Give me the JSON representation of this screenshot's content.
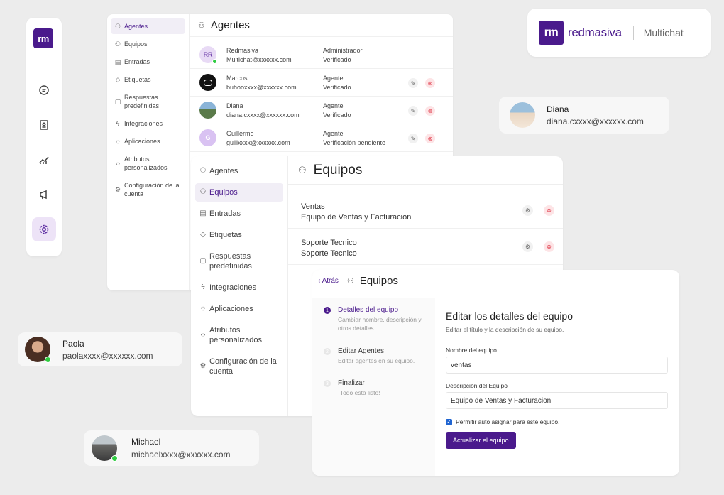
{
  "brand": {
    "mark": "rm",
    "name": "redmasiva",
    "product": "Multichat"
  },
  "rail": {
    "logo": "rm",
    "icons": [
      "chat-icon",
      "contacts-icon",
      "reports-icon",
      "campaigns-icon",
      "settings-icon"
    ]
  },
  "agentes_panel": {
    "title": "Agentes",
    "sidebar": [
      {
        "label": "Agentes",
        "icon": "agents-icon"
      },
      {
        "label": "Equipos",
        "icon": "teams-icon"
      },
      {
        "label": "Entradas",
        "icon": "inbox-icon"
      },
      {
        "label": "Etiquetas",
        "icon": "tag-icon"
      },
      {
        "label": "Respuestas predefinidas",
        "icon": "message-icon"
      },
      {
        "label": "Integraciones",
        "icon": "plug-icon"
      },
      {
        "label": "Aplicaciones",
        "icon": "apps-icon"
      },
      {
        "label": "Atributos personalizados",
        "icon": "code-icon"
      },
      {
        "label": "Configuración de la cuenta",
        "icon": "settings-icon"
      }
    ],
    "agents": [
      {
        "initials": "RR",
        "name": "Redmasiva",
        "email": "Multichat@xxxxxx.com",
        "role": "Administrador",
        "status": "Verificado"
      },
      {
        "initials": "",
        "name": "Marcos",
        "email": "buhooxxxx@xxxxxx.com",
        "role": "Agente",
        "status": "Verificado"
      },
      {
        "initials": "",
        "name": "Diana",
        "email": "diana.cxxxx@xxxxxx.com",
        "role": "Agente",
        "status": "Verificado"
      },
      {
        "initials": "G",
        "name": "Guillermo",
        "email": "gullixxxx@xxxxxx.com",
        "role": "Agente",
        "status": "Verificación pendiente"
      }
    ]
  },
  "equipos_panel": {
    "title": "Equipos",
    "sidebar": [
      {
        "label": "Agentes",
        "icon": "agents-icon"
      },
      {
        "label": "Equipos",
        "icon": "teams-icon"
      },
      {
        "label": "Entradas",
        "icon": "inbox-icon"
      },
      {
        "label": "Etiquetas",
        "icon": "tag-icon"
      },
      {
        "label": "Respuestas predefinidas",
        "icon": "message-icon"
      },
      {
        "label": "Integraciones",
        "icon": "plug-icon"
      },
      {
        "label": "Aplicaciones",
        "icon": "apps-icon"
      },
      {
        "label": "Atributos personalizados",
        "icon": "code-icon"
      },
      {
        "label": "Configuración de la cuenta",
        "icon": "settings-icon"
      }
    ],
    "teams": [
      {
        "name": "Ventas",
        "description": "Equipo de Ventas y Facturacion"
      },
      {
        "name": "Soporte Tecnico",
        "description": "Soporte Tecnico"
      }
    ]
  },
  "edit_panel": {
    "back": "Atrás",
    "title": "Equipos",
    "steps": [
      {
        "num": "1",
        "title": "Detalles del equipo",
        "desc": "Cambiar nombre, descripción y otros detalles."
      },
      {
        "num": "2",
        "title": "Editar Agentes",
        "desc": "Editar agentes en su equipo."
      },
      {
        "num": "3",
        "title": "Finalizar",
        "desc": "¡Todo está listo!"
      }
    ],
    "form": {
      "heading": "Editar los detalles del equipo",
      "subheading": "Editar el título y la descripción de su equipo.",
      "name_label": "Nombre del equipo",
      "name_value": "ventas",
      "desc_label": "Descripción del Equipo",
      "desc_value": "Equipo de Ventas y Facturacion",
      "checkbox_label": "Permitir auto asignar para este equipo.",
      "checkbox_checked": true,
      "submit": "Actualizar el equipo"
    }
  },
  "contacts": [
    {
      "name": "Diana",
      "email": "diana.cxxxx@xxxxxx.com"
    },
    {
      "name": "Paola",
      "email": "paolaxxxx@xxxxxx.com"
    },
    {
      "name": "Michael",
      "email": "michaelxxxx@xxxxxx.com"
    }
  ],
  "colors": {
    "brand": "#4a1a8c",
    "online": "#2ecc40",
    "danger": "#e0404f",
    "checkbox": "#2065d1"
  }
}
